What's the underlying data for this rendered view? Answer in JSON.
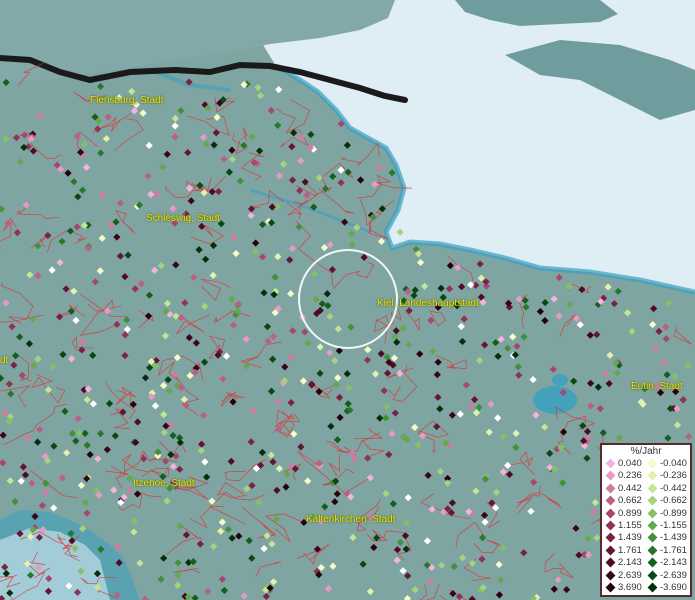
{
  "map": {
    "cities": [
      {
        "key": "flensburg",
        "label": "Flensburg, Stadt"
      },
      {
        "key": "schleswig",
        "label": "Schleswig, Stadt"
      },
      {
        "key": "kiel",
        "label": "Kiel, Landeshauptstadt"
      },
      {
        "key": "eutin",
        "label": "Eutin, Stadt"
      },
      {
        "key": "itzehoe",
        "label": "Itzehoe, Stadt"
      },
      {
        "key": "kaltenkirchen",
        "label": "Kaltenkirchen, Stadt"
      },
      {
        "key": "left_edge",
        "label": "dt"
      }
    ],
    "colors": {
      "land": "#7fa5a3",
      "sea": "#dfeef5",
      "water": "#3aa0c0",
      "border": "#e03030"
    }
  },
  "legend": {
    "title": "%/Jahr",
    "positive": [
      {
        "value": "0.040",
        "color": "#f4b2df"
      },
      {
        "value": "0.236",
        "color": "#e89ac6"
      },
      {
        "value": "0.442",
        "color": "#d27aa2"
      },
      {
        "value": "0.662",
        "color": "#bb5f86"
      },
      {
        "value": "0.899",
        "color": "#a5476f"
      },
      {
        "value": "1.155",
        "color": "#8f3358"
      },
      {
        "value": "1.439",
        "color": "#7a2244"
      },
      {
        "value": "1.761",
        "color": "#651533"
      },
      {
        "value": "2.143",
        "color": "#4f0b24"
      },
      {
        "value": "2.639",
        "color": "#3b0517"
      },
      {
        "value": "3.690",
        "color": "#27020c"
      }
    ],
    "negative": [
      {
        "value": "-0.040",
        "color": "#f4fcc8"
      },
      {
        "value": "-0.236",
        "color": "#e0f2ab"
      },
      {
        "value": "-0.442",
        "color": "#c5e592"
      },
      {
        "value": "-0.662",
        "color": "#a5d47c"
      },
      {
        "value": "-0.899",
        "color": "#86c065"
      },
      {
        "value": "-1.155",
        "color": "#63a94d"
      },
      {
        "value": "-1.439",
        "color": "#42903a"
      },
      {
        "value": "-1.761",
        "color": "#28782a"
      },
      {
        "value": "-2.143",
        "color": "#145f1c"
      },
      {
        "value": "-2.639",
        "color": "#074813"
      },
      {
        "value": "-3.690",
        "color": "#02300b"
      }
    ]
  }
}
